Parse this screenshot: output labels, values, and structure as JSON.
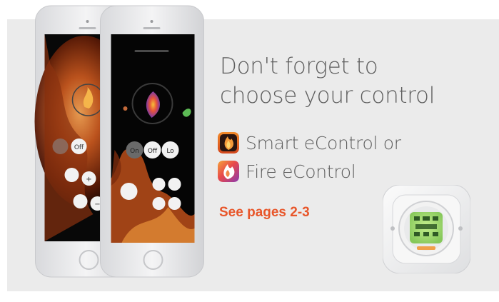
{
  "colors": {
    "panel_bg": "#ebebeb",
    "headline": "#5e5e5e",
    "accent": "#e8562a",
    "phone_frame": "#e9eaec",
    "screen_bg": "#050505",
    "flame": "#c4561e",
    "thermostat_screen": "#9fd86e"
  },
  "headline": {
    "line1": "Don't forget to",
    "line2": "choose your control"
  },
  "apps": [
    {
      "icon": "smart-econtrol-app-icon",
      "label": "Smart eControl or"
    },
    {
      "icon": "fire-econtrol-app-icon",
      "label": "Fire eControl"
    }
  ],
  "cta": {
    "label": "See pages 2-3"
  },
  "phone_back": {
    "buttons": [
      "Off",
      "+",
      "−"
    ]
  },
  "phone_front": {
    "buttons": [
      "On",
      "Off",
      "Lo"
    ]
  }
}
